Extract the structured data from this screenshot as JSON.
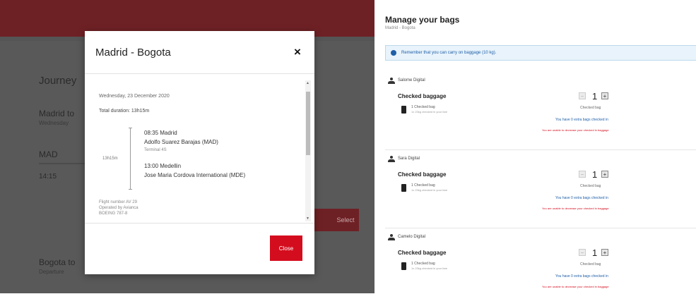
{
  "background": {
    "heading": "Journey",
    "route_1": "Madrid to",
    "route_1_sub": "Wednesday",
    "code_1": "MAD",
    "code_2": "14:15",
    "button_label": "Select",
    "route_2": "Bogota to",
    "route_2_sub": "Departure"
  },
  "modal": {
    "title": "Madrid - Bogota",
    "close_icon": "×",
    "date": "Wednesday, 23 December 2020",
    "total_duration": "Total duration: 13h15m",
    "leg_duration": "13h15m",
    "departure_time": "08:35 Madrid",
    "departure_airport": "Adolfo Suarez Barajas (MAD)",
    "departure_terminal": "Terminal 4S",
    "arrival_time": "13:00 Medellin",
    "arrival_airport": "Jose Maria Cordova International (MDE)",
    "flight_number": "Flight number AV 29",
    "operated_by": "Operated by Avianca",
    "aircraft": "BOEING 787-8",
    "close_button_label": "Close"
  },
  "manage": {
    "title": "Manage your bags",
    "subtitle": "Madrid - Bogota",
    "notice": "Remember that you can carry on baggage (10 kg).",
    "section_label": "Checked baggage",
    "bag_count_label": "1 Checked bag",
    "bag_weight_label": "1x 23kg checked in your fare",
    "checked_bag_caption": "Checked bag",
    "extra_bags_note": "You have 0 extra bags checked in",
    "decrease_warning": "You are unable to decrease your checked in baggage",
    "passengers": [
      {
        "name": "Salome Digital",
        "quantity": "1"
      },
      {
        "name": "Sara Digital",
        "quantity": "1"
      },
      {
        "name": "Camelo Digital",
        "quantity": "1"
      }
    ]
  },
  "colors": {
    "brand_dark_red": "#6e2125",
    "close_button_red": "#d40d1e",
    "link_blue": "#1f5fa8",
    "notice_bg": "#e8f3fb"
  }
}
